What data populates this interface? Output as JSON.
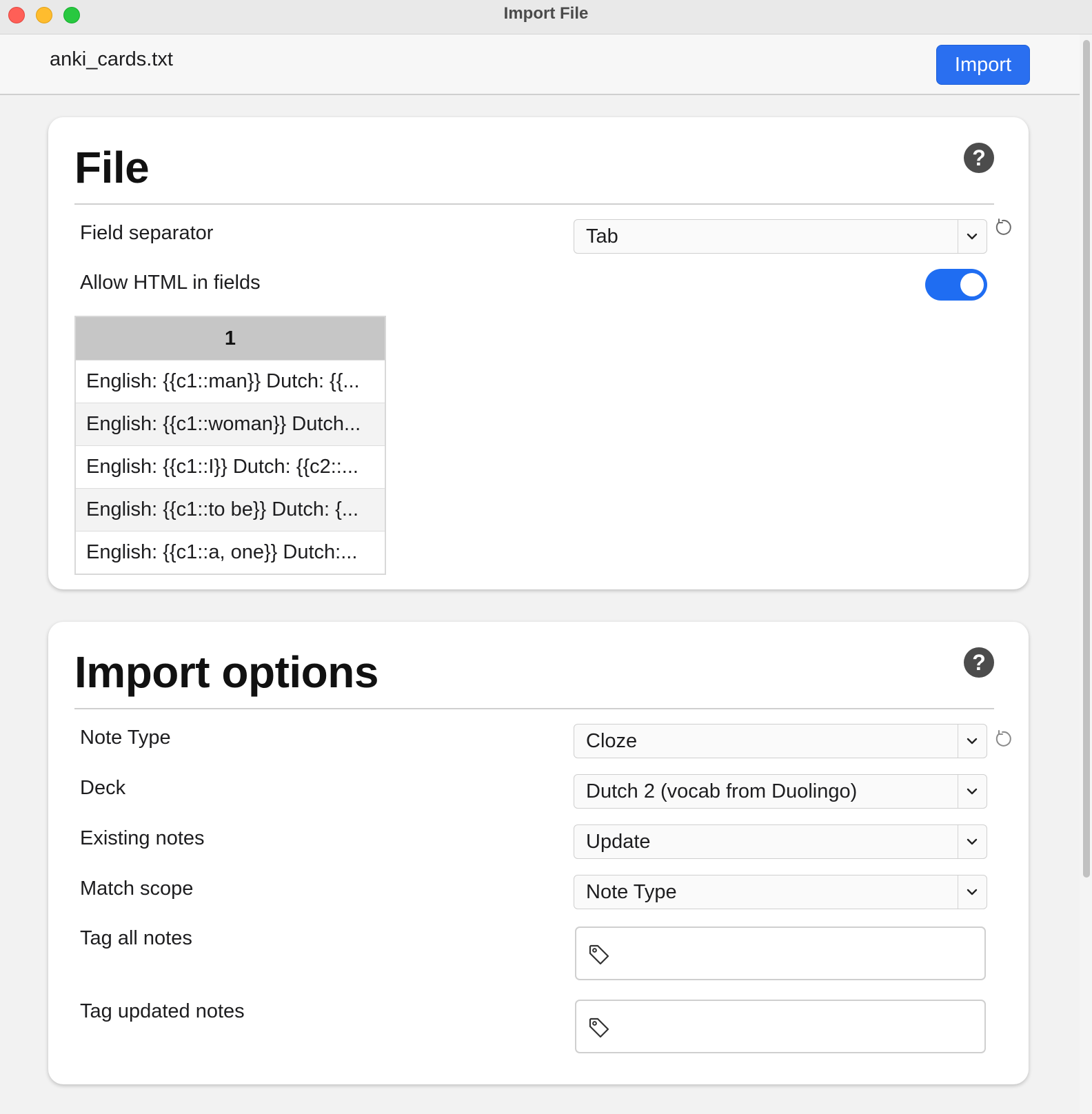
{
  "window": {
    "title": "Import File"
  },
  "header": {
    "filename": "anki_cards.txt",
    "import_label": "Import"
  },
  "file_section": {
    "title": "File",
    "help_glyph": "?",
    "field_separator": {
      "label": "Field separator",
      "value": "Tab"
    },
    "allow_html": {
      "label": "Allow HTML in fields",
      "enabled": true
    },
    "preview": {
      "column_header": "1",
      "rows": [
        "English: {{c1::man}} Dutch: {{...",
        "English: {{c1::woman}} Dutch...",
        "English: {{c1::I}} Dutch: {{c2::...",
        "English: {{c1::to be}} Dutch: {...",
        "English: {{c1::a, one}} Dutch:..."
      ]
    }
  },
  "options_section": {
    "title": "Import options",
    "help_glyph": "?",
    "note_type": {
      "label": "Note Type",
      "value": "Cloze"
    },
    "deck": {
      "label": "Deck",
      "value": "Dutch 2 (vocab from Duolingo)"
    },
    "existing_notes": {
      "label": "Existing notes",
      "value": "Update"
    },
    "match_scope": {
      "label": "Match scope",
      "value": "Note Type"
    },
    "tag_all_notes": {
      "label": "Tag all notes",
      "value": ""
    },
    "tag_updated_notes": {
      "label": "Tag updated notes",
      "value": ""
    }
  },
  "icons": {
    "dropdown": "chevron-down-icon",
    "reset": "reset-icon",
    "tag": "tag-icon",
    "help": "help-icon"
  },
  "colors": {
    "accent": "#2a6ff0",
    "toggle_on": "#1f6df2"
  }
}
